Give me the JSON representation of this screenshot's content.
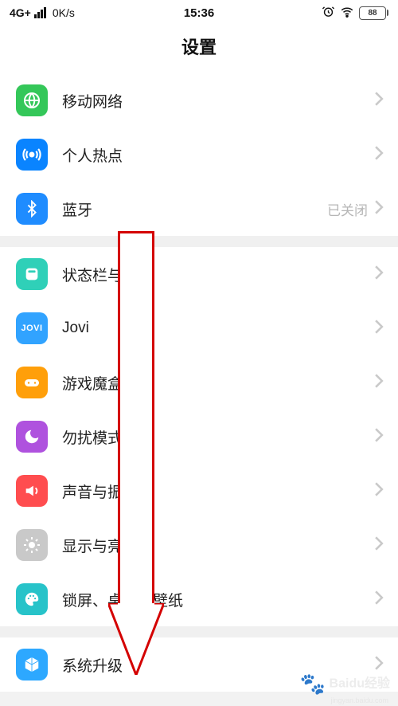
{
  "status": {
    "network": "4G+",
    "speed": "0K/s",
    "time": "15:36",
    "battery": "88"
  },
  "title": "设置",
  "group1": [
    {
      "label": "移动网络",
      "value": ""
    },
    {
      "label": "个人热点",
      "value": ""
    },
    {
      "label": "蓝牙",
      "value": "已关闭"
    }
  ],
  "group2": [
    {
      "label": "状态栏与通知",
      "value": ""
    },
    {
      "label": "Jovi",
      "value": ""
    },
    {
      "label": "游戏魔盒",
      "value": ""
    },
    {
      "label": "勿扰模式",
      "value": ""
    },
    {
      "label": "声音与振动",
      "value": ""
    },
    {
      "label": "显示与亮度",
      "value": ""
    },
    {
      "label": "锁屏、桌面与壁纸",
      "value": ""
    }
  ],
  "group3": [
    {
      "label": "系统升级",
      "value": ""
    }
  ],
  "watermark": {
    "brand": "Baidu经验",
    "url": "jingyan.baidu.com"
  }
}
